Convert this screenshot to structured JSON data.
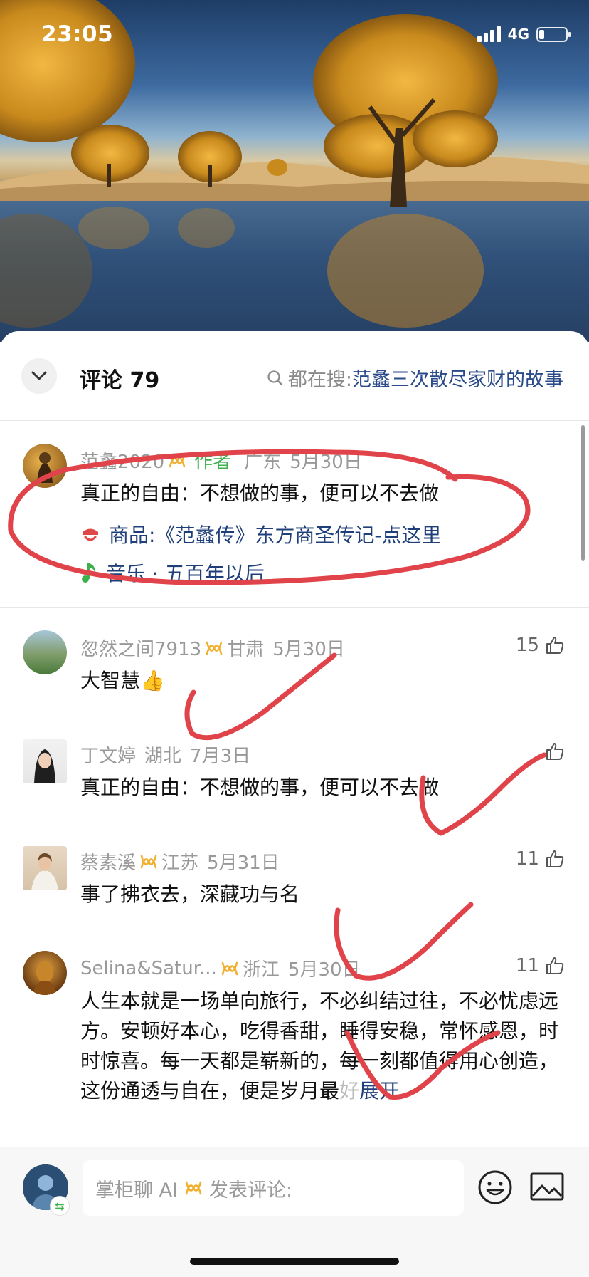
{
  "status_bar": {
    "time": "23:05",
    "network": "4G",
    "battery_level": 0.2
  },
  "header": {
    "comments_label": "评论 79",
    "search_prefix": "都在搜:",
    "search_query": "范蠡三次散尽家财的故事"
  },
  "comments": [
    {
      "user": "范蠡2020",
      "author_tag": "作者",
      "location": "广东",
      "date": "5月30日",
      "text": "真正的自由：不想做的事，便可以不去做",
      "product_label": "商品:《范蠡传》东方商圣传记-点这里",
      "music_label": "音乐 · 五百年以后"
    },
    {
      "user": "忽然之间7913",
      "location": "甘肃",
      "date": "5月30日",
      "text": "大智慧👍",
      "likes": "15"
    },
    {
      "user": "丁文婷",
      "location": "湖北",
      "date": "7月3日",
      "text": "真正的自由：不想做的事，便可以不去做",
      "likes": ""
    },
    {
      "user": "蔡素溪",
      "location": "江苏",
      "date": "5月31日",
      "text": "事了拂衣去，深藏功与名",
      "likes": "11"
    },
    {
      "user": "Selina&Satur...",
      "location": "浙江",
      "date": "5月30日",
      "text": "人生本就是一场单向旅行，不必纠结过往，不必忧虑远方。安顿好本心，吃得香甜，睡得安稳，常怀感恩，时时惊喜。每一天都是崭新的，每一刻都值得用心创造，这份通透与自在，便是岁月最",
      "text_fade": "好",
      "expand_label": "展开",
      "likes": "11"
    }
  ],
  "bottom_bar": {
    "input_prefix": "掌柜聊 AI",
    "input_placeholder": "发表评论:"
  },
  "colors": {
    "accent_link": "#1f3f7a",
    "author_green": "#3cb04a",
    "annotation_red": "#e0444a"
  }
}
